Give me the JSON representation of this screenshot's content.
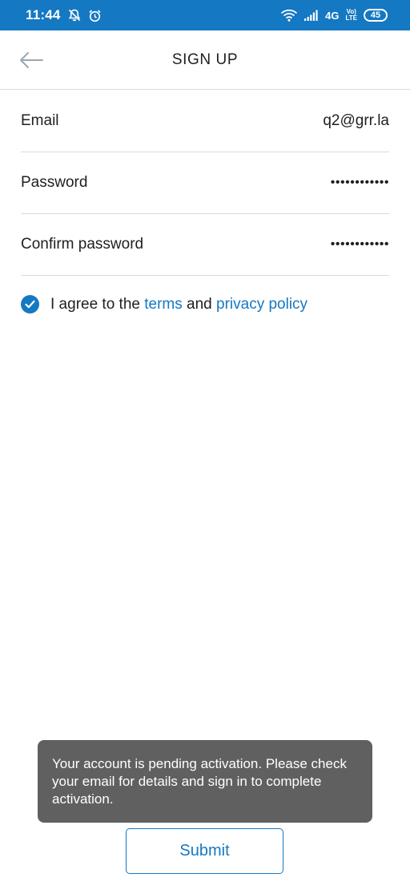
{
  "status_bar": {
    "time": "11:44",
    "network": "4G",
    "volte_top": "Vo)",
    "volte_bottom": "LTE",
    "battery": "45",
    "background": "#1578c2",
    "icons": [
      "muted-notifications-icon",
      "alarm-icon",
      "wifi-icon",
      "signal-icon"
    ]
  },
  "header": {
    "title": "SIGN UP",
    "back_icon": "arrow-left-icon"
  },
  "form": {
    "email": {
      "label": "Email",
      "value": "q2@grr.la"
    },
    "password": {
      "label": "Password",
      "value": "••••••••••••"
    },
    "confirm_password": {
      "label": "Confirm password",
      "value": "••••••••••••"
    }
  },
  "agreement": {
    "checked": true,
    "prefix": "I agree to the ",
    "terms_link": "terms",
    "middle": " and ",
    "privacy_link": "privacy policy"
  },
  "toast": {
    "message": "Your account is pending activation. Please check your email for details and sign in to complete activation."
  },
  "submit": {
    "label": "Submit"
  },
  "colors": {
    "accent": "#1578c2",
    "toast_bg": "#606060",
    "divider": "#cfdde5"
  }
}
